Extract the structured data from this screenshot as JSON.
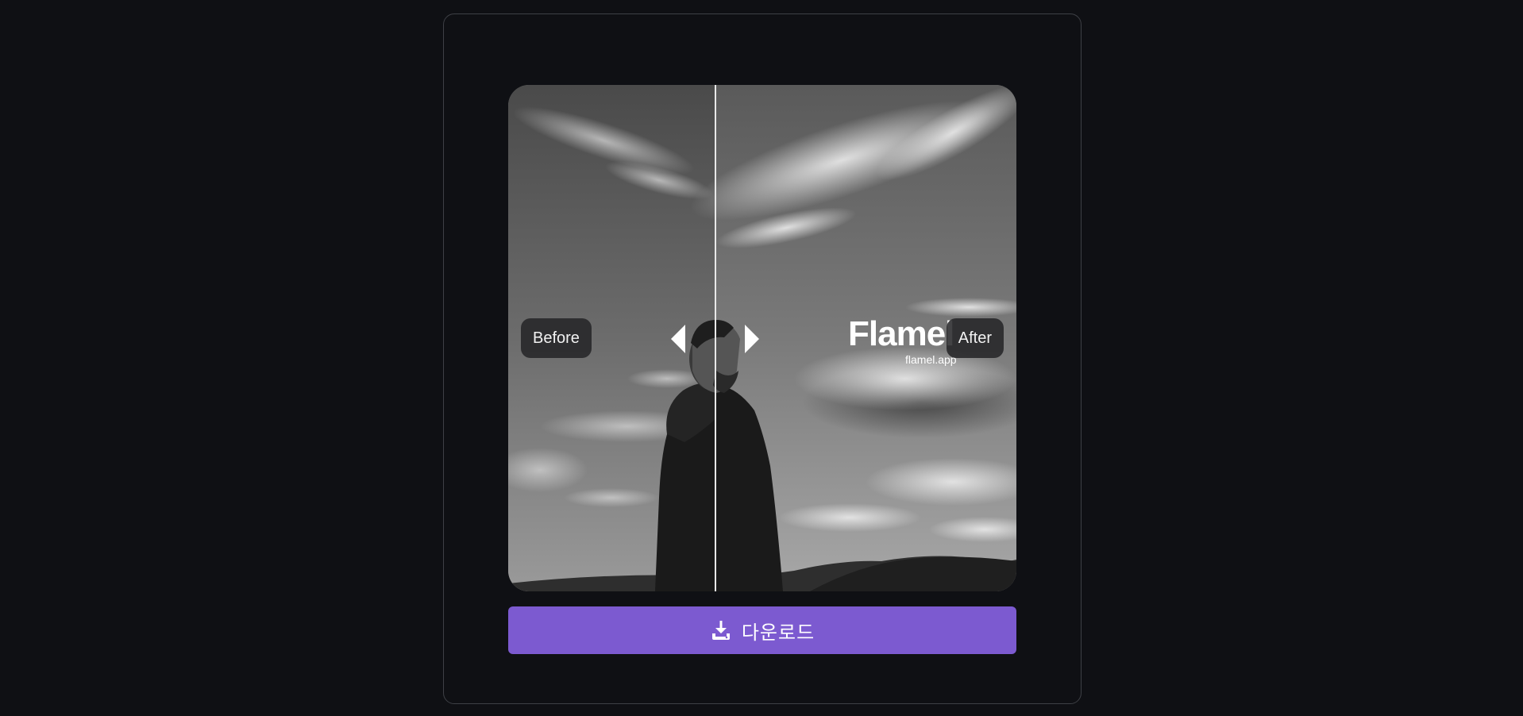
{
  "comparison": {
    "before_label": "Before",
    "after_label": "After",
    "divider_position": 0.41
  },
  "watermark": {
    "title": "Flamel",
    "subtitle": "flamel.app"
  },
  "download": {
    "label": "다운로드",
    "icon": "download-icon",
    "color": "#7c5ad0"
  }
}
